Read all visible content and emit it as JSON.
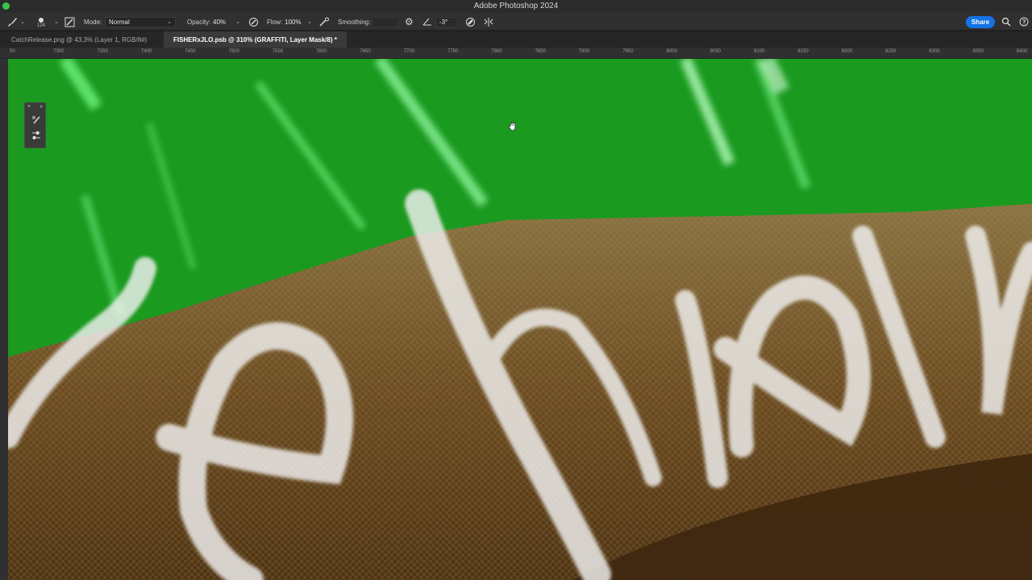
{
  "window": {
    "title": "Adobe Photoshop 2024"
  },
  "options_bar": {
    "brush_size": "124",
    "mode_label": "Mode:",
    "mode_value": "Normal",
    "opacity_label": "Opacity:",
    "opacity_value": "40%",
    "flow_label": "Flow:",
    "flow_value": "100%",
    "smoothing_label": "Smoothing:",
    "angle_value": "-3°",
    "share_label": "Share"
  },
  "tabs": [
    {
      "label": "CatchRelease.png @ 43,3% (Layer 1, RGB/8#)",
      "active": false
    },
    {
      "label": "FISHERxJLO.psb @ 310% (GRAFFITI, Layer Mask/8) *",
      "active": true
    }
  ],
  "ruler": {
    "ticks": [
      "50",
      "7300",
      "7350",
      "7400",
      "7450",
      "7500",
      "7550",
      "7600",
      "7650",
      "7700",
      "7750",
      "7800",
      "7850",
      "7900",
      "7950",
      "8000",
      "8050",
      "8100",
      "8150",
      "8200",
      "8250",
      "8300",
      "8350",
      "8400"
    ]
  },
  "colors": {
    "accent": "#1473e6",
    "canvas_green": "#169c1c",
    "garment_brown": "#7a5a2c",
    "graffiti_white": "#f2f2f2"
  },
  "icons": {
    "brush_tool": "brush-icon",
    "brush_settings": "brush-settings-icon",
    "pressure_opacity": "pressure-opacity-icon",
    "airbrush": "airbrush-icon",
    "smoothing_settings": "gear-icon",
    "angle": "angle-icon",
    "pressure_size": "pressure-size-icon",
    "symmetry": "symmetry-icon",
    "search": "search-icon",
    "help": "help-icon",
    "hand_cursor": "hand-cursor-icon"
  }
}
